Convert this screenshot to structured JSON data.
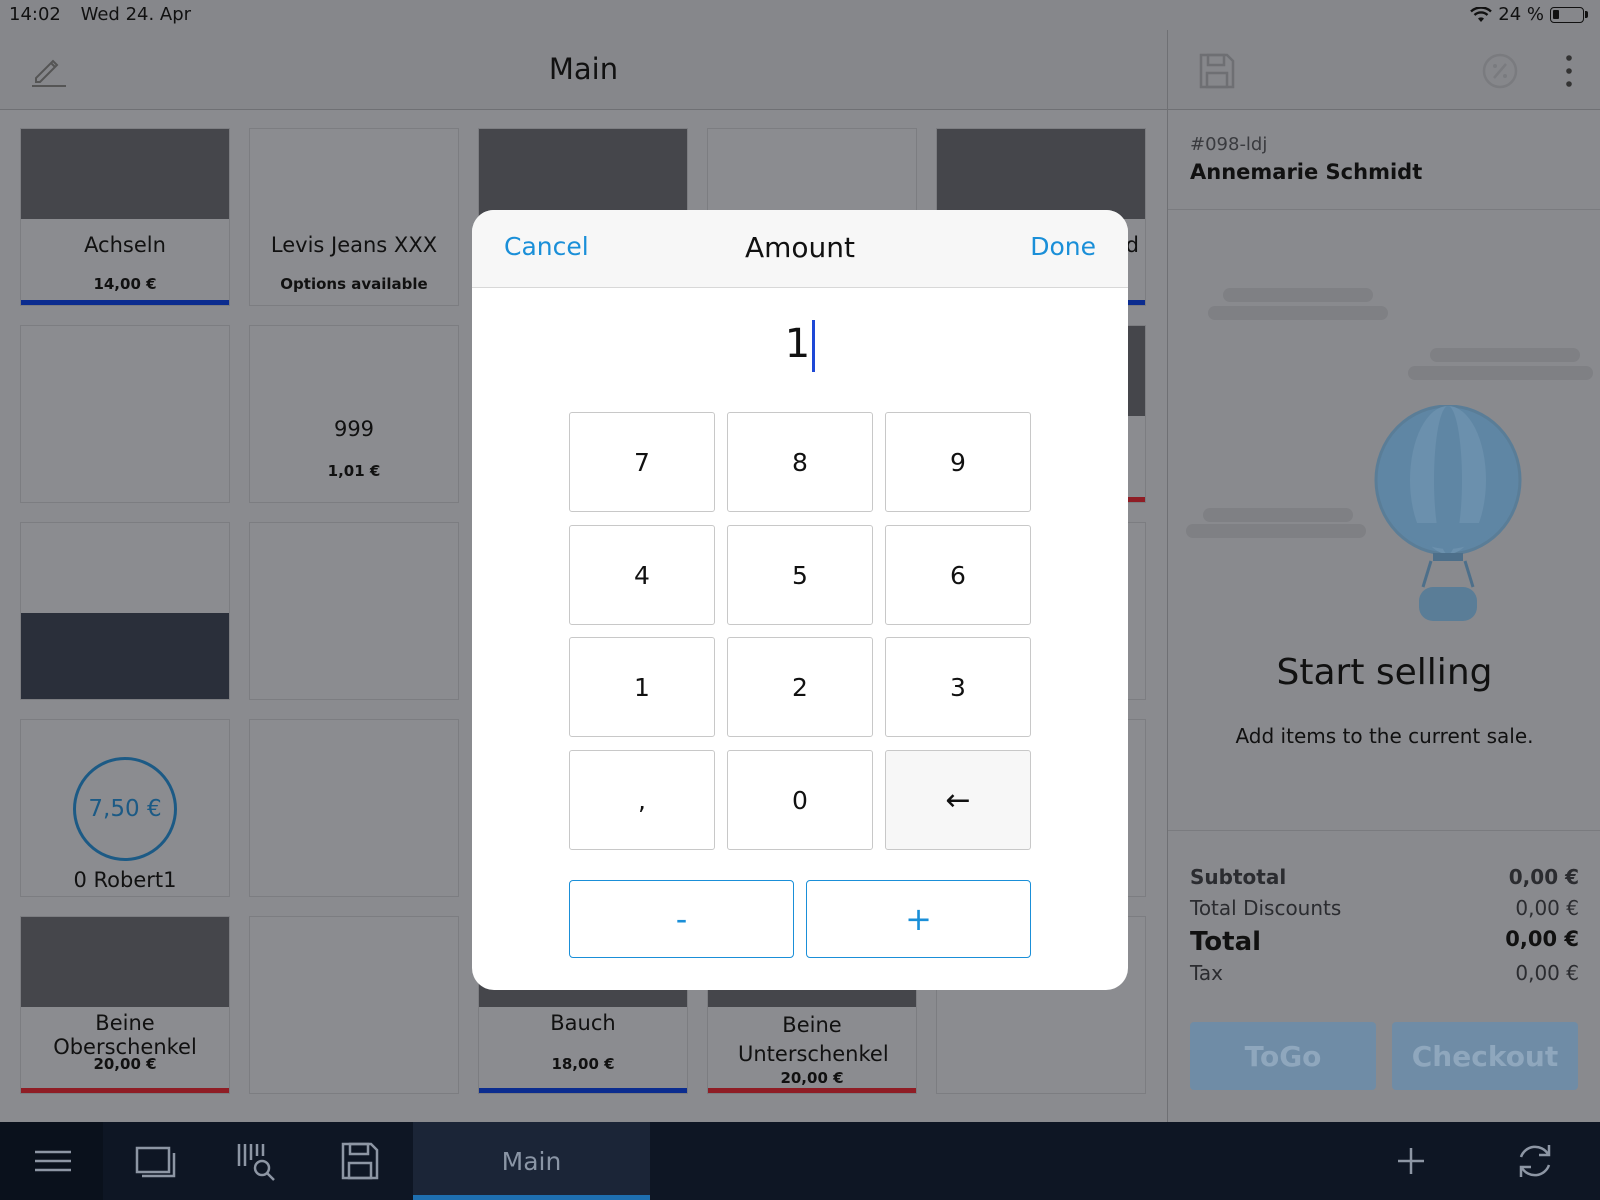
{
  "status_bar": {
    "time": "14:02",
    "date": "Wed 24. Apr",
    "battery": "24 %"
  },
  "left_header": {
    "title": "Main"
  },
  "tiles": [
    {
      "name": "Achseln",
      "price": "14,00 €"
    },
    {
      "name": "Levis Jeans XXX",
      "price": "Options available"
    },
    {
      "name": "999",
      "price": "1,01 €"
    },
    {
      "name": "0 Robert1",
      "circle_price": "7,50 €"
    },
    {
      "name": "Beine Oberschenkel",
      "price": "20,00 €"
    },
    {
      "name": "Bauch",
      "price": "18,00 €"
    },
    {
      "name": "Beine Unterschenkel",
      "price": "20,00 €"
    },
    {
      "name": "d"
    }
  ],
  "customer": {
    "id": "#098-ldj",
    "name": "Annemarie Schmidt"
  },
  "empty_state": {
    "title": "Start selling",
    "subtitle": "Add items to the current sale."
  },
  "totals": {
    "subtotal_label": "Subtotal",
    "subtotal": "0,00 €",
    "discounts_label": "Total Discounts",
    "discounts": "0,00 €",
    "total_label": "Total",
    "total": "0,00 €",
    "tax_label": "Tax",
    "tax": "0,00 €"
  },
  "actions": {
    "togo": "ToGo",
    "checkout": "Checkout"
  },
  "bottom_bar": {
    "active_tab": "Main"
  },
  "modal": {
    "cancel": "Cancel",
    "title": "Amount",
    "done": "Done",
    "value": "1",
    "keys": [
      "7",
      "8",
      "9",
      "4",
      "5",
      "6",
      "1",
      "2",
      "3",
      ",",
      "0",
      "←"
    ],
    "minus": "-",
    "plus": "+"
  },
  "colors": {
    "accent": "#1a8fd8",
    "bottom_bar": "#0e1624",
    "checkout_button": "#6f8ca6"
  }
}
